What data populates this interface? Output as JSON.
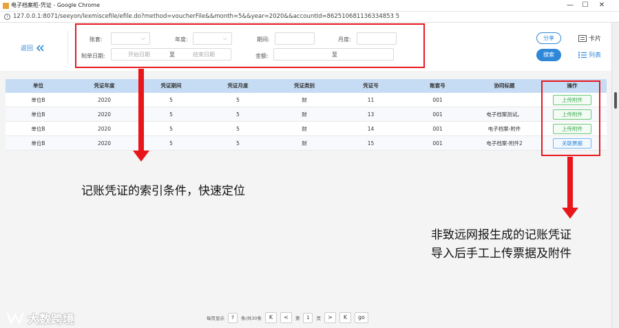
{
  "window": {
    "title": "电子档案柜-凭证 - Google Chrome",
    "url": "127.0.0.1:8071/seeyon/lexmiscefile/efile.do?method=voucherFile&&month=5&&year=2020&&accountId=862510681136334853 5",
    "controls": {
      "minimize": "—",
      "maximize": "☐",
      "close": "✕"
    }
  },
  "header": {
    "back_label": "返回",
    "filters": {
      "account_set_label": "账套:",
      "year_label": "年度:",
      "period_label": "期间:",
      "month_label": "月度:",
      "date_label": "制单日期:",
      "date_start_placeholder": "开始日期",
      "date_to": "至",
      "date_end_placeholder": "结束日期",
      "amount_label": "金额:",
      "amount_to": "至"
    },
    "share_label": "分享",
    "search_label": "搜索",
    "view_card_label": "卡片",
    "view_list_label": "列表"
  },
  "table": {
    "columns": [
      "单位",
      "凭证年度",
      "凭证期间",
      "凭证月度",
      "凭证类别",
      "凭证号",
      "账套号",
      "协同标题",
      "操作"
    ],
    "rows": [
      {
        "unit": "单位B",
        "year": "2020",
        "period": "5",
        "month": "5",
        "type": "财",
        "no": "11",
        "account": "001",
        "title": "",
        "action": "上传附件",
        "action_style": "green"
      },
      {
        "unit": "单位B",
        "year": "2020",
        "period": "5",
        "month": "5",
        "type": "财",
        "no": "13",
        "account": "001",
        "title": "电子档案测试。",
        "action": "上传附件",
        "action_style": "green"
      },
      {
        "unit": "单位B",
        "year": "2020",
        "period": "5",
        "month": "5",
        "type": "财",
        "no": "14",
        "account": "001",
        "title": "电子档案-附件",
        "action": "上传附件",
        "action_style": "green"
      },
      {
        "unit": "单位B",
        "year": "2020",
        "period": "5",
        "month": "5",
        "type": "财",
        "no": "15",
        "account": "001",
        "title": "电子档案-附件2",
        "action": "关联票据",
        "action_style": "blue"
      }
    ]
  },
  "annotations": {
    "note1": "记账凭证的索引条件，快速定位",
    "note2_line1": "非致远网报生成的记账凭证",
    "note2_line2": "导入后手工上传票据及附件",
    "color": "#e8161b"
  },
  "pagination": {
    "per_page_label": "每页显示",
    "per_page_value": "7",
    "total_label": "条/共30条",
    "first": "K",
    "prev": "<",
    "page_prefix": "第",
    "page_value": "1",
    "page_suffix": "页",
    "next": ">",
    "last": "K",
    "go": "go"
  },
  "watermark": "大数跨境"
}
